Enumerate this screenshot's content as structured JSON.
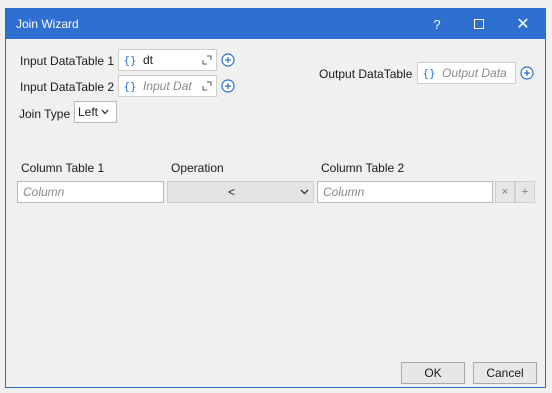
{
  "window": {
    "title": "Join Wizard"
  },
  "titlebar": {
    "help": "?",
    "close": "✕"
  },
  "inputs": {
    "table1": {
      "label": "Input DataTable 1",
      "brace": "{}",
      "value": "dt"
    },
    "table2": {
      "label": "Input DataTable 2",
      "brace": "{}",
      "placeholder": "Input Dat"
    },
    "output": {
      "label": "Output DataTable",
      "brace": "{}",
      "placeholder": "Output Data"
    }
  },
  "join_type": {
    "label": "Join Type",
    "value": "Left"
  },
  "columns": {
    "headers": [
      "Column Table 1",
      "Operation",
      "Column Table 2"
    ],
    "rows": [
      {
        "col1_placeholder": "Column",
        "operation": "<",
        "col2_placeholder": "Column"
      }
    ],
    "remove_label": "×",
    "add_label": "+"
  },
  "buttons": {
    "ok": "OK",
    "cancel": "Cancel"
  },
  "icons": [
    "expand-icon",
    "add-circle-icon",
    "chevron-down-icon",
    "help-icon",
    "maximize-icon",
    "close-icon"
  ]
}
